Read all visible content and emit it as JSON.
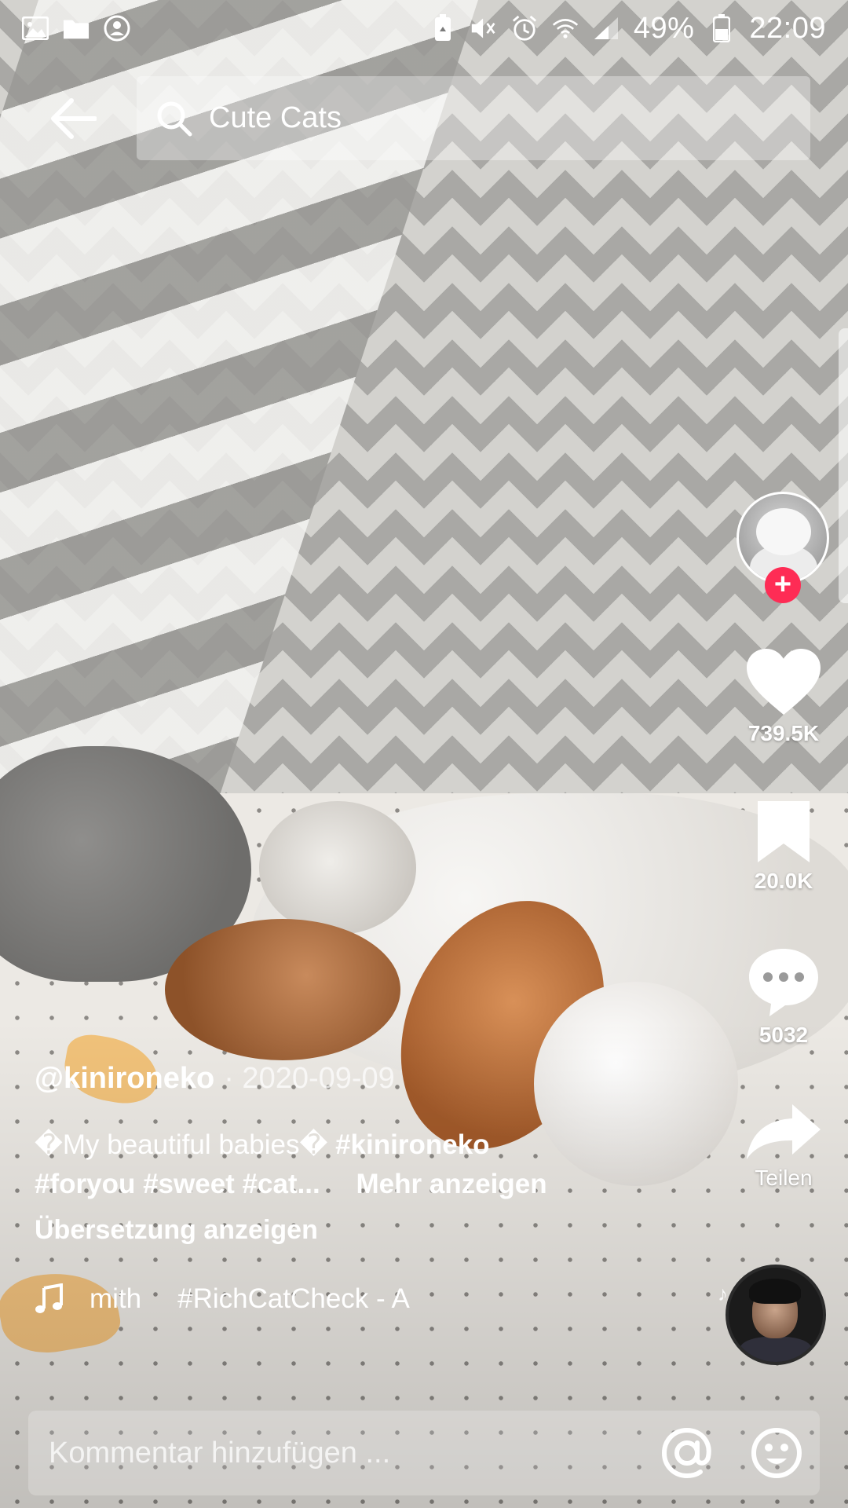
{
  "status_bar": {
    "battery_percent_label": "49%",
    "time": "22:09",
    "icons_left": [
      "gallery-icon",
      "folder-icon",
      "account-circle-icon"
    ],
    "icons_right": [
      "recycle-battery-icon",
      "mute-icon",
      "alarm-icon",
      "wifi-icon",
      "signal-icon",
      "battery-icon"
    ]
  },
  "header": {
    "back_icon": "arrow-left-icon",
    "search_text": "Cute Cats"
  },
  "actions": {
    "like_count": "739.5K",
    "save_count": "20.0K",
    "comment_count": "5032",
    "share_label": "Teilen"
  },
  "post": {
    "author": "@kinironeko",
    "date": "· 2020-09-09",
    "desc_text": "�My beautiful babies�",
    "hashtags_line1": "#kinironeko",
    "hashtags_line2": "#foryou #sweet #cat...",
    "more_label": "Mehr anzeigen",
    "translate_label": "Übersetzung anzeigen",
    "music_artist": "mith",
    "music_title": "#RichCatCheck - A"
  },
  "comment_bar": {
    "placeholder": "Kommentar hinzufügen ..."
  },
  "colors": {
    "follow_accent": "#fe2c55",
    "text": "#ffffff"
  }
}
